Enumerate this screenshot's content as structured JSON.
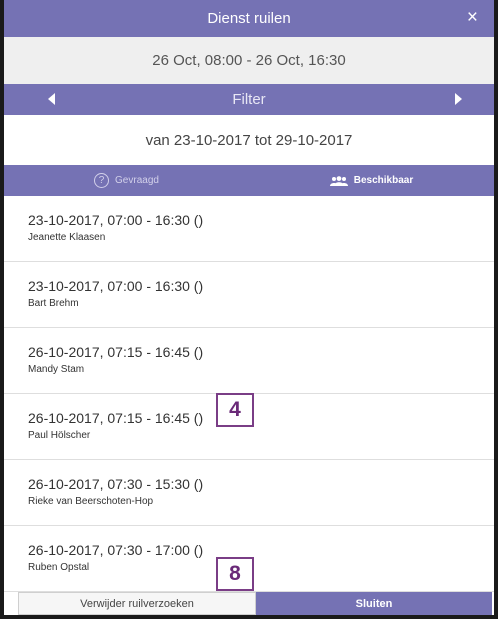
{
  "dialog": {
    "title": "Dienst ruilen",
    "close_icon": "×"
  },
  "shift_range": "26 Oct, 08:00 - 26 Oct, 16:30",
  "filter": {
    "label": "Filter"
  },
  "period": "van 23-10-2017 tot 29-10-2017",
  "tabs": [
    {
      "label": "Gevraagd",
      "icon": "question-circle-icon",
      "active": false
    },
    {
      "label": "Beschikbaar",
      "icon": "users-icon",
      "active": true
    }
  ],
  "items": [
    {
      "when": "23-10-2017, 07:00 - 16:30 ()",
      "who": "Jeanette Klaasen"
    },
    {
      "when": "23-10-2017, 07:00 - 16:30 ()",
      "who": "Bart Brehm"
    },
    {
      "when": "26-10-2017, 07:15 - 16:45 ()",
      "who": "Mandy Stam"
    },
    {
      "when": "26-10-2017, 07:15 - 16:45 ()",
      "who": "Paul Hölscher"
    },
    {
      "when": "26-10-2017, 07:30 - 15:30 ()",
      "who": "Rieke van Beerschoten-Hop"
    },
    {
      "when": "26-10-2017, 07:30 - 17:00 ()",
      "who": "Ruben Opstal"
    }
  ],
  "annotations": [
    "4",
    "8"
  ],
  "buttons": {
    "remove": "Verwijder ruilverzoeken",
    "close": "Sluiten"
  },
  "colors": {
    "accent": "#7572b4",
    "annotation": "#7a3d86"
  }
}
